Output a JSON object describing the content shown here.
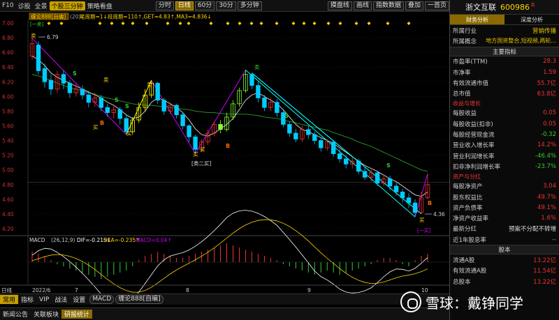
{
  "topbar": {
    "items": [
      "F10",
      "诊股",
      "全景",
      "个股三分钟",
      "策略看盘"
    ],
    "period_buttons": [
      "分时",
      "日线",
      "60分",
      "30分",
      "多分钟"
    ],
    "right_buttons": [
      "摸盘线",
      "画线",
      "指数数据",
      "叠加",
      "一首页"
    ]
  },
  "indicator_header": {
    "name": "缠论888[自编]",
    "text": "(20)",
    "values": "笔周期=1↓段周期=110↑,GET=4.83↑,MA3=4.836↓"
  },
  "price_axis": [
    "7.00",
    "6.80",
    "6.60",
    "6.40",
    "6.20",
    "6.00",
    "5.80",
    "5.60",
    "5.40",
    "5.20",
    "5.00",
    "4.80",
    "4.60",
    "4.40",
    "4.20"
  ],
  "annotations": {
    "top_price": "6.79",
    "low_price": "4.36",
    "label_one_buy": "[一买]",
    "label_two_buy": "[类二买]",
    "label_one_sell": "[一卖]",
    "label_sell": "卖",
    "label_buy": "买",
    "label_s": "S",
    "label_b": "B"
  },
  "macd": {
    "label": "MACD",
    "params": "(26,12,9)",
    "dif": "DIF=-0.215↓",
    "dea": "DEA=-0.235↑",
    "macd_val": "MACD=0.04↑"
  },
  "date_axis": [
    "日线",
    "2022/6",
    "7",
    "8",
    "9",
    "10"
  ],
  "bottom_toolbar": {
    "items": [
      "常用",
      "指标",
      "VIP",
      "战法",
      "设置"
    ],
    "macd_tab": "MACD",
    "indicator_tab": "缠论888[自编]"
  },
  "status_bar": {
    "items": [
      "新闻公告",
      "关联板块",
      "研报统计"
    ]
  },
  "stock": {
    "name": "浙文互联",
    "code": "600986",
    "flag": "R"
  },
  "right_tabs": [
    "财务分析",
    "深度分析"
  ],
  "finance": {
    "industry_label": "所属行业",
    "industry": "营销传播",
    "concept_label": "所属概念",
    "concept": "地方国资整合,短视频,两轮...",
    "main_section": "主要指标",
    "main_rows": [
      [
        "市盈率(TTM)",
        "28.3"
      ],
      [
        "市净率",
        "1.59"
      ],
      [
        "有效流通市值",
        "55.7亿"
      ],
      [
        "总市值",
        "63.8亿"
      ]
    ],
    "growth_section": "收益与增长",
    "growth_rows": [
      [
        "每股收益",
        "0.05"
      ],
      [
        "每股收益(扣非)",
        "0.05"
      ],
      [
        "每股经营现金流",
        "-0.32"
      ],
      [
        "营业收入增长率",
        "14.2%"
      ],
      [
        "营业利润增长率",
        "-46.4%"
      ],
      [
        "扣非净利润增长率",
        "-23.7%"
      ]
    ],
    "asset_section": "资产与分红",
    "asset_rows": [
      [
        "每股净资产",
        "3.04"
      ],
      [
        "股东权益比",
        "49.7%"
      ],
      [
        "资产负债率",
        "49.1%"
      ],
      [
        "净资产收益率",
        "1.6%"
      ]
    ],
    "dividend_rows": [
      [
        "最新分红",
        "预案不分配不转增"
      ],
      [
        "近1年股息率",
        "--"
      ]
    ],
    "capital_section": "股本",
    "capital_rows": [
      [
        "流通A股",
        "13.22亿"
      ],
      [
        "有效流通A股",
        "11.54亿"
      ],
      [
        "总股本",
        "13.22亿"
      ]
    ]
  },
  "watermark": {
    "text": "雪球：戴铮同学"
  },
  "candles": [
    [
      6.55,
      6.72,
      6.79,
      6.5
    ],
    [
      6.7,
      6.35,
      6.75,
      6.3
    ],
    [
      6.38,
      6.2,
      6.45,
      6.12
    ],
    [
      6.22,
      6.1,
      6.3,
      6.02
    ],
    [
      6.1,
      6.3,
      6.35,
      6.05
    ],
    [
      6.3,
      6.18,
      6.36,
      6.1
    ],
    [
      6.18,
      6.05,
      6.22,
      5.98
    ],
    [
      6.05,
      6.1,
      6.18,
      6.0
    ],
    [
      6.1,
      6.02,
      6.15,
      5.96
    ],
    [
      6.02,
      5.92,
      6.08,
      5.85
    ],
    [
      5.92,
      5.98,
      6.05,
      5.86
    ],
    [
      5.98,
      5.85,
      6.02,
      5.8
    ],
    [
      5.85,
      5.78,
      5.9,
      5.72
    ],
    [
      5.78,
      5.82,
      5.88,
      5.7
    ],
    [
      5.82,
      5.7,
      5.86,
      5.62
    ],
    [
      5.7,
      5.52,
      5.75,
      5.48
    ],
    [
      5.52,
      5.68,
      5.72,
      5.48
    ],
    [
      5.68,
      5.85,
      5.92,
      5.64
    ],
    [
      5.85,
      6.02,
      6.1,
      5.8
    ],
    [
      6.02,
      6.18,
      6.22,
      5.98
    ],
    [
      6.18,
      5.95,
      6.2,
      5.9
    ],
    [
      5.95,
      5.8,
      5.98,
      5.75
    ],
    [
      5.8,
      5.88,
      5.92,
      5.76
    ],
    [
      5.88,
      5.75,
      5.9,
      5.7
    ],
    [
      5.75,
      5.6,
      5.78,
      5.55
    ],
    [
      5.6,
      5.45,
      5.62,
      5.38
    ],
    [
      5.45,
      5.28,
      5.48,
      5.22
    ],
    [
      5.28,
      5.38,
      5.42,
      5.24
    ],
    [
      5.38,
      5.5,
      5.55,
      5.34
    ],
    [
      5.5,
      5.62,
      5.66,
      5.46
    ],
    [
      5.62,
      5.55,
      5.68,
      5.5
    ],
    [
      5.55,
      5.72,
      5.78,
      5.52
    ],
    [
      5.72,
      5.9,
      5.95,
      5.68
    ],
    [
      5.9,
      6.08,
      6.12,
      5.86
    ],
    [
      6.08,
      6.3,
      6.36,
      6.05
    ],
    [
      6.3,
      6.15,
      6.32,
      6.1
    ],
    [
      6.15,
      5.98,
      6.2,
      5.92
    ],
    [
      5.98,
      5.85,
      6.02,
      5.8
    ],
    [
      5.85,
      5.92,
      5.98,
      5.8
    ],
    [
      5.92,
      5.78,
      5.96,
      5.72
    ],
    [
      5.78,
      5.62,
      5.82,
      5.58
    ],
    [
      5.62,
      5.5,
      5.66,
      5.45
    ],
    [
      5.5,
      5.42,
      5.56,
      5.38
    ],
    [
      5.42,
      5.55,
      5.6,
      5.38
    ],
    [
      5.55,
      5.48,
      5.6,
      5.42
    ],
    [
      5.48,
      5.4,
      5.52,
      5.35
    ],
    [
      5.4,
      5.3,
      5.44,
      5.25
    ],
    [
      5.3,
      5.38,
      5.42,
      5.26
    ],
    [
      5.38,
      5.22,
      5.4,
      5.18
    ],
    [
      5.22,
      5.15,
      5.28,
      5.1
    ],
    [
      5.15,
      5.08,
      5.2,
      5.02
    ],
    [
      5.08,
      5.12,
      5.18,
      5.02
    ],
    [
      5.12,
      4.98,
      5.15,
      4.94
    ],
    [
      4.98,
      4.9,
      5.04,
      4.86
    ],
    [
      4.9,
      4.96,
      5.0,
      4.84
    ],
    [
      4.96,
      4.82,
      4.98,
      4.78
    ],
    [
      4.82,
      4.88,
      4.94,
      4.78
    ],
    [
      4.88,
      4.78,
      4.92,
      4.72
    ],
    [
      4.78,
      4.7,
      4.82,
      4.65
    ],
    [
      4.7,
      4.62,
      4.74,
      4.56
    ],
    [
      4.62,
      4.55,
      4.68,
      4.48
    ],
    [
      4.55,
      4.42,
      4.6,
      4.36
    ],
    [
      4.42,
      4.62,
      4.7,
      4.4
    ],
    [
      4.62,
      4.8,
      4.95,
      4.6
    ]
  ],
  "ma_lines": {
    "long": [
      6.3,
      6.28,
      6.25,
      6.22,
      6.18,
      6.15,
      6.12,
      6.1,
      6.08,
      6.05,
      6.03,
      6.0,
      5.98,
      5.96,
      5.94,
      5.92,
      5.9,
      5.89,
      5.88,
      5.88,
      5.87,
      5.86,
      5.85,
      5.84,
      5.83,
      5.82,
      5.8,
      5.79,
      5.78,
      5.78,
      5.77,
      5.76,
      5.76,
      5.76,
      5.76,
      5.75,
      5.74,
      5.72,
      5.71,
      5.7,
      5.68,
      5.66,
      5.64,
      5.62,
      5.6,
      5.58,
      5.56,
      5.54,
      5.51,
      5.48,
      5.45,
      5.42,
      5.38,
      5.35,
      5.32,
      5.28,
      5.24,
      5.2,
      5.16,
      5.12,
      5.08,
      5.04,
      5.0,
      4.98
    ],
    "short": [
      6.55,
      6.5,
      6.42,
      6.32,
      6.26,
      6.22,
      6.18,
      6.14,
      6.1,
      6.06,
      6.02,
      5.98,
      5.92,
      5.88,
      5.82,
      5.75,
      5.7,
      5.72,
      5.8,
      5.92,
      5.98,
      5.95,
      5.9,
      5.85,
      5.78,
      5.68,
      5.56,
      5.48,
      5.46,
      5.5,
      5.56,
      5.62,
      5.7,
      5.82,
      5.95,
      6.02,
      6.05,
      6.0,
      5.95,
      5.9,
      5.82,
      5.72,
      5.62,
      5.55,
      5.52,
      5.48,
      5.44,
      5.4,
      5.36,
      5.3,
      5.24,
      5.18,
      5.12,
      5.06,
      5.02,
      4.98,
      4.93,
      4.88,
      4.84,
      4.78,
      4.72,
      4.66,
      4.64,
      4.7
    ]
  },
  "macd_hist": [
    0.05,
    0.04,
    0.03,
    0.01,
    -0.01,
    -0.02,
    -0.03,
    -0.04,
    -0.05,
    -0.06,
    -0.07,
    -0.08,
    -0.07,
    -0.06,
    -0.05,
    -0.04,
    -0.02,
    0.01,
    0.03,
    0.04,
    0.05,
    0.04,
    0.03,
    0.02,
    0.02,
    0.03,
    0.04,
    0.05,
    0.06,
    0.07,
    0.08,
    0.09,
    0.08,
    0.07,
    0.06,
    0.05,
    0.04,
    0.03,
    0.02,
    0.01,
    -0.01,
    -0.02,
    -0.03,
    -0.04,
    -0.05,
    -0.06,
    -0.05,
    -0.04,
    -0.05,
    -0.06,
    -0.05,
    -0.04,
    -0.03,
    -0.02,
    -0.01,
    0.01,
    0.02,
    0.02,
    0.01,
    -0.01,
    -0.02,
    0.01,
    0.03,
    0.04
  ]
}
